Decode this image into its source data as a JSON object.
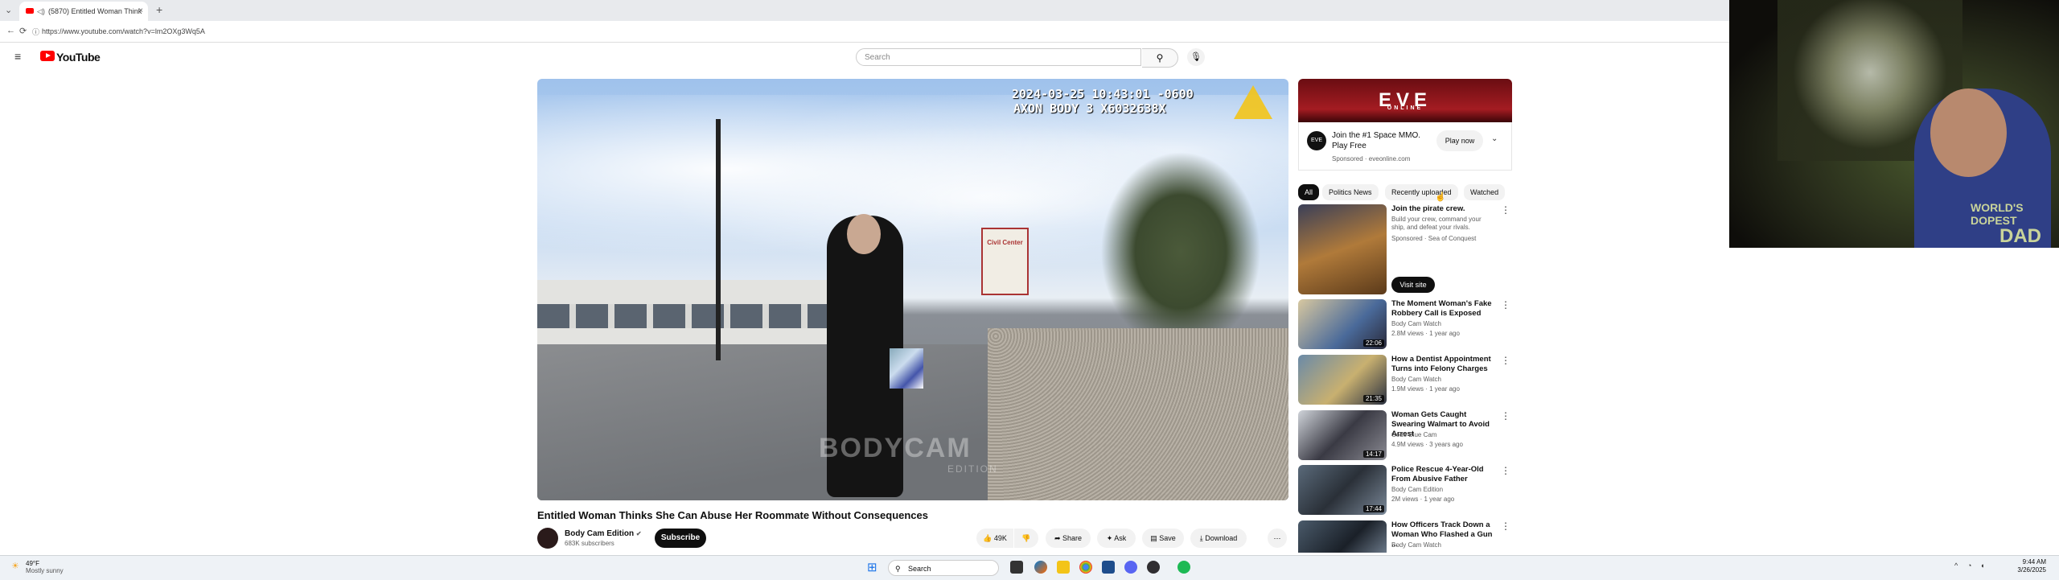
{
  "browser": {
    "tab_title": "(5870) Entitled Woman Think",
    "tab_close": "×",
    "new_tab": "+",
    "address": "https://www.youtube.com/watch?v=lm2OXg3Wq5A",
    "back": "←",
    "reload": "⟳",
    "info": "ⓘ"
  },
  "header": {
    "menu_icon": "≡",
    "logo_text": "YouTube",
    "search_placeholder": "Search",
    "search_icon": "⚲",
    "mic_icon": "🎙"
  },
  "video": {
    "timestamp_line1": "2024-03-25 10:43:01 -0600",
    "timestamp_line2": "AXON BODY 3 X6032638X",
    "watermark": "BODYCAM",
    "watermark_sub": "EDITION",
    "sign_text": "Civil Center",
    "title": "Entitled Woman Thinks She Can Abuse Her Roommate Without Consequences",
    "channel": "Body Cam Edition",
    "verified": "✔",
    "subscribers": "683K subscribers",
    "subscribe_label": "Subscribe",
    "actions": {
      "likes": "49K",
      "share": "Share",
      "ask": "Ask",
      "save": "Save",
      "download": "Download",
      "more": "⋯"
    }
  },
  "ad": {
    "banner": "EVE",
    "banner_sub": "ONLINE",
    "icon_label": "EVE",
    "headline": "Join the #1 Space MMO. Play Free",
    "sponsored": "Sponsored · eveonline.com",
    "cta": "Play now",
    "chevron": "⌄"
  },
  "chips": [
    "All",
    "Politics News",
    "Recently uploaded",
    "Watched"
  ],
  "recommendations": [
    {
      "title": "Join the pirate crew.",
      "channel": "Build your crew, command your ship, and defeat your rivals.",
      "meta": "Sponsored · Sea of Conquest",
      "duration": "",
      "cta": "Visit site"
    },
    {
      "title": "The Moment Woman's Fake Robbery Call is Exposed",
      "channel": "Body Cam Watch",
      "meta": "2.8M views · 1 year ago",
      "duration": "22:06"
    },
    {
      "title": "How a Dentist Appointment Turns into Felony Charges",
      "channel": "Body Cam Watch",
      "meta": "1.9M views · 1 year ago",
      "duration": "21:35"
    },
    {
      "title": "Woman Gets Caught Swearing Walmart to Avoid Arrest",
      "channel": "Code Blue Cam",
      "meta": "4.9M views · 3 years ago",
      "duration": "14:17"
    },
    {
      "title": "Police Rescue 4-Year-Old From Abusive Father",
      "channel": "Body Cam Edition",
      "meta": "2M views · 1 year ago",
      "duration": "17:44"
    },
    {
      "title": "How Officers Track Down a Woman Who Flashed a Gun ...",
      "channel": "Body Cam Watch",
      "meta": "",
      "duration": ""
    }
  ],
  "webcam": {
    "shirt_line1": "WORLD'S DOPEST",
    "shirt_line2": "DAD"
  },
  "taskbar": {
    "weather_temp": "49°F",
    "weather_desc": "Mostly sunny",
    "search_label": "Search",
    "time": "9:44 AM",
    "date": "3/26/2025",
    "tray_arrow": "^",
    "wifi_icon": "◔",
    "volume_icon": "◖"
  },
  "colors": {
    "youtube_red": "#ff0000",
    "chip_active": "#0f0f0f",
    "ad_red": "#a41c22"
  }
}
